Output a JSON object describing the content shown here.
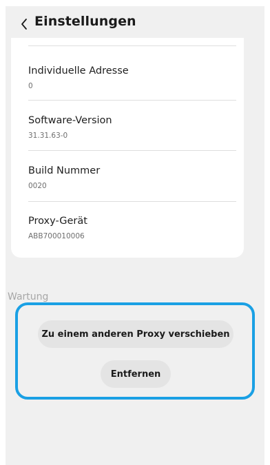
{
  "header": {
    "back_icon": "chevron-left-icon",
    "title": "Einstellungen"
  },
  "details": [
    {
      "label": "Individuelle Adresse",
      "value": "0"
    },
    {
      "label": "Software-Version",
      "value": "31.31.63-0"
    },
    {
      "label": "Build Nummer",
      "value": "0020"
    },
    {
      "label": "Proxy-Gerät",
      "value": "ABB700010006"
    }
  ],
  "maintenance": {
    "section_label": "Wartung",
    "move_button": "Zu einem anderen Proxy verschieben",
    "remove_button": "Entfernen",
    "highlight_color": "#1aa0e4"
  },
  "colors": {
    "background": "#f0f0f0",
    "card": "#ffffff",
    "button": "#e4e4e4"
  }
}
